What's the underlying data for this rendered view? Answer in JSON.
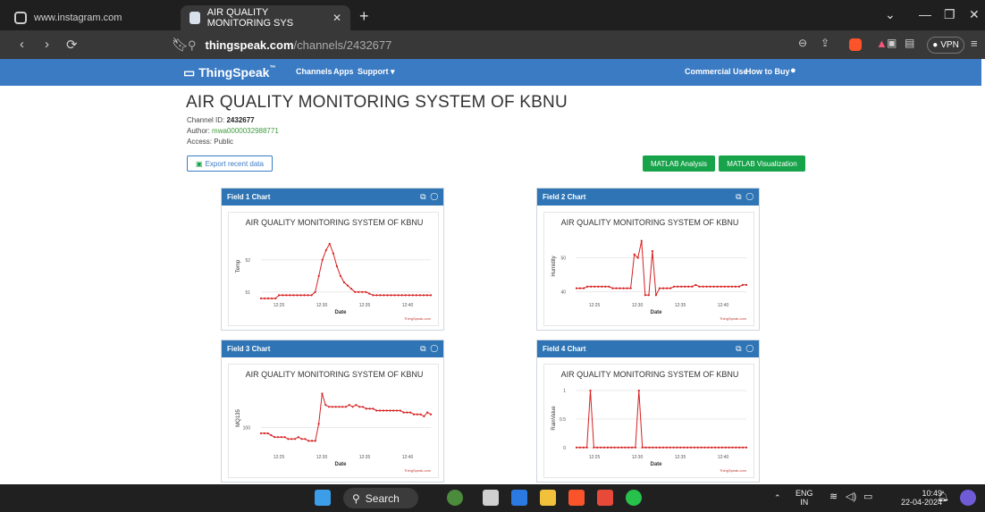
{
  "browser": {
    "tabs": [
      {
        "label": "www.instagram.com"
      },
      {
        "label": "AIR QUALITY MONITORING SYS"
      }
    ],
    "url_domain": "thingspeak.com",
    "url_path": "/channels/2432677",
    "vpn_label": "VPN"
  },
  "header": {
    "logo": "ThingSpeak",
    "nav": [
      "Channels",
      "Apps",
      "Support"
    ],
    "right": [
      "Commercial Use",
      "How to Buy"
    ]
  },
  "channel": {
    "title": "AIR QUALITY MONITORING SYSTEM OF KBNU",
    "id_label": "Channel ID:",
    "id_value": "2432677",
    "author_label": "Author:",
    "author_value": "mwa0000032988771",
    "access_label": "Access:",
    "access_value": "Public",
    "export_label": "Export recent data",
    "matlab_analysis": "MATLAB Analysis",
    "matlab_visualization": "MATLAB Visualization"
  },
  "chart_data": [
    {
      "type": "line",
      "panel": "Field 1 Chart",
      "title": "AIR QUALITY MONITORING SYSTEM OF KBNU",
      "xlabel": "Date",
      "ylabel": "Temp",
      "credit": "ThingSpeak.com",
      "x_ticks": [
        "12:25",
        "12:30",
        "12:35",
        "12:40"
      ],
      "y_ticks": [
        51,
        52
      ],
      "ylim": [
        50.8,
        52.8
      ],
      "values": [
        50.8,
        50.8,
        50.8,
        50.8,
        50.8,
        50.9,
        50.9,
        50.9,
        50.9,
        50.9,
        50.9,
        50.9,
        50.9,
        50.9,
        50.9,
        51.0,
        51.5,
        52.0,
        52.3,
        52.5,
        52.2,
        51.8,
        51.5,
        51.3,
        51.2,
        51.1,
        51.0,
        51.0,
        51.0,
        51.0,
        50.95,
        50.9,
        50.9,
        50.9,
        50.9,
        50.9,
        50.9,
        50.9,
        50.9,
        50.9,
        50.9,
        50.9,
        50.9,
        50.9,
        50.9,
        50.9,
        50.9,
        50.9
      ]
    },
    {
      "type": "line",
      "panel": "Field 2 Chart",
      "title": "AIR QUALITY MONITORING SYSTEM OF KBNU",
      "xlabel": "Date",
      "ylabel": "Humidity",
      "credit": "ThingSpeak.com",
      "x_ticks": [
        "12:25",
        "12:30",
        "12:35",
        "12:40"
      ],
      "y_ticks": [
        40,
        50
      ],
      "ylim": [
        38,
        57
      ],
      "values": [
        41,
        41,
        41,
        41.5,
        41.5,
        41.5,
        41.5,
        41.5,
        41.5,
        41.5,
        41,
        41,
        41,
        41,
        41,
        41,
        51,
        50,
        55,
        39,
        39,
        52,
        39,
        41,
        41,
        41,
        41,
        41.5,
        41.5,
        41.5,
        41.5,
        41.5,
        41.5,
        42,
        41.5,
        41.5,
        41.5,
        41.5,
        41.5,
        41.5,
        41.5,
        41.5,
        41.5,
        41.5,
        41.5,
        41.5,
        42,
        42
      ]
    },
    {
      "type": "line",
      "panel": "Field 3 Chart",
      "title": "AIR QUALITY MONITORING SYSTEM OF KBNU",
      "xlabel": "Date",
      "ylabel": "MQ135",
      "credit": "ThingSpeak.com",
      "x_ticks": [
        "12:25",
        "12:30",
        "12:35",
        "12:40"
      ],
      "y_ticks": [
        100
      ],
      "ylim": [
        88,
        122
      ],
      "values": [
        97,
        97,
        97,
        96,
        95,
        95,
        95,
        95,
        94,
        94,
        94,
        95,
        94,
        94,
        93,
        93,
        93,
        102,
        118,
        112,
        111,
        111,
        111,
        111,
        111,
        111,
        112,
        111,
        112,
        111,
        111,
        110,
        110,
        110,
        109,
        109,
        109,
        109,
        109,
        109,
        109,
        109,
        108,
        108,
        108,
        107,
        107,
        107,
        106,
        108,
        107
      ]
    },
    {
      "type": "line",
      "panel": "Field 4 Chart",
      "title": "AIR QUALITY MONITORING SYSTEM OF KBNU",
      "xlabel": "Date",
      "ylabel": "RainValue",
      "credit": "ThingSpeak.com",
      "x_ticks": [
        "12:25",
        "12:30",
        "12:35",
        "12:40"
      ],
      "y_ticks": [
        0,
        0.5,
        1
      ],
      "ylim": [
        -0.05,
        1.08
      ],
      "values": [
        0,
        0,
        0,
        0,
        1,
        0,
        0,
        0,
        0,
        0,
        0,
        0,
        0,
        0,
        0,
        0,
        0,
        0,
        1,
        0,
        0,
        0,
        0,
        0,
        0,
        0,
        0,
        0,
        0,
        0,
        0,
        0,
        0,
        0,
        0,
        0,
        0,
        0,
        0,
        0,
        0,
        0,
        0,
        0,
        0,
        0,
        0,
        0,
        0,
        0
      ]
    }
  ],
  "taskbar": {
    "search_label": "Search",
    "lang_top": "ENG",
    "lang_bottom": "IN",
    "time": "10:49",
    "date": "22-04-2024"
  }
}
